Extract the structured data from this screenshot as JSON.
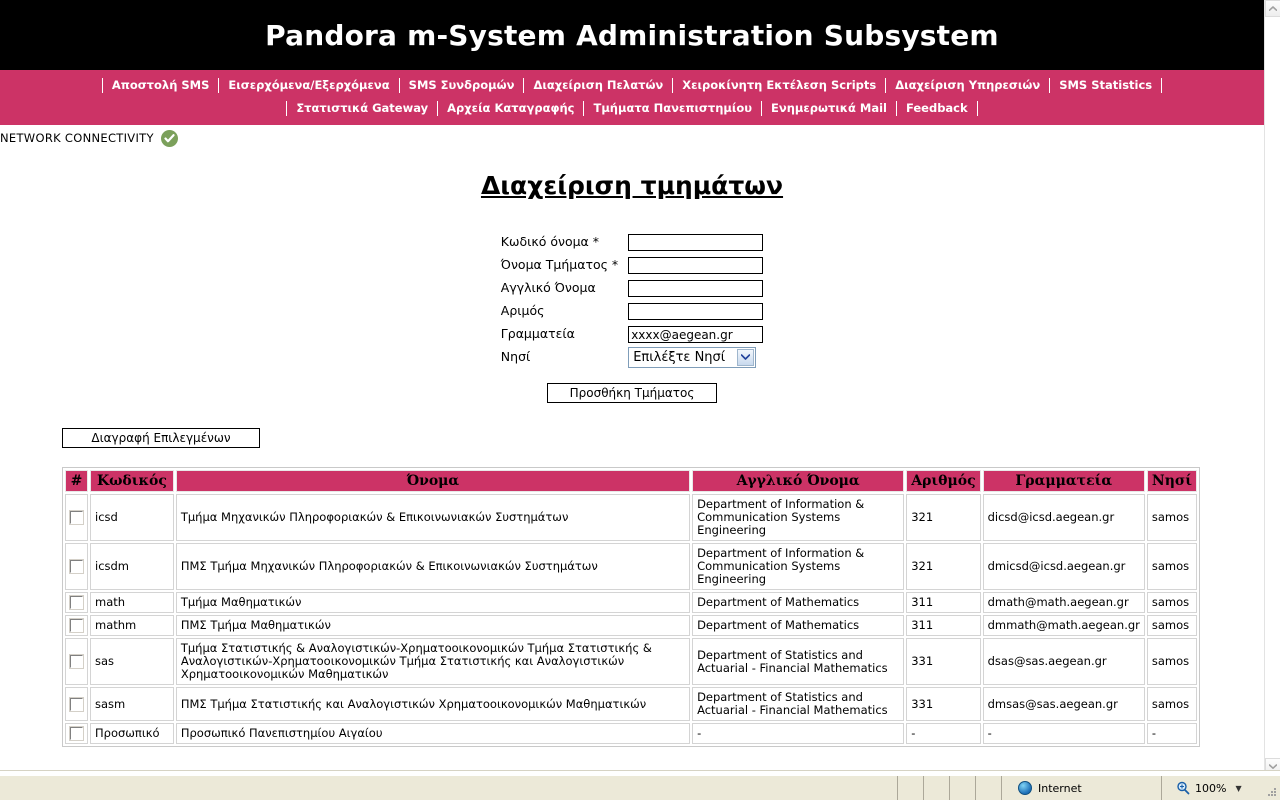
{
  "banner": {
    "title": "Pandora m-System Administration Subsystem"
  },
  "colors": {
    "banner_bg": "#000000",
    "nav_bg": "#cc3366",
    "table_header_bg": "#cc3366",
    "status_ok": "#7ba05b"
  },
  "nav": {
    "row1": [
      {
        "label": "Αποστολή SMS"
      },
      {
        "label": "Εισερχόμενα/Εξερχόμενα"
      },
      {
        "label": "SMS Συνδρομών"
      },
      {
        "label": "Διαχείριση Πελατών"
      },
      {
        "label": "Χειροκίνητη Εκτέλεση Scripts"
      },
      {
        "label": "Διαχείριση Υπηρεσιών"
      },
      {
        "label": "SMS Statistics"
      }
    ],
    "row2": [
      {
        "label": "Στατιστικά Gateway"
      },
      {
        "label": "Αρχεία Καταγραφής"
      },
      {
        "label": "Τμήματα Πανεπιστημίου"
      },
      {
        "label": "Ενημερωτικά Mail"
      },
      {
        "label": "Feedback"
      }
    ]
  },
  "connectivity": {
    "label": "NETWORK CONNECTIVITY",
    "icon": "check-circle-icon",
    "state": "ok"
  },
  "page": {
    "title": "Διαχείριση τμημάτων"
  },
  "form": {
    "fields": [
      {
        "label": "Κωδικό όνομα *",
        "value": "",
        "placeholder": ""
      },
      {
        "label": "Όνομα Τμήματος *",
        "value": "",
        "placeholder": ""
      },
      {
        "label": "Αγγλικό Όνομα",
        "value": "",
        "placeholder": ""
      },
      {
        "label": "Αριμός",
        "value": "",
        "placeholder": ""
      },
      {
        "label": "Γραμματεία",
        "value": "xxxx@aegean.gr",
        "placeholder": ""
      }
    ],
    "island": {
      "label": "Νησί",
      "selected": "Επιλέξτε Νησί",
      "options": [
        "Επιλέξτε Νησί"
      ]
    },
    "submit_label": "Προσθήκη Τμήματος"
  },
  "actions": {
    "delete_selected_label": "Διαγραφή Επιλεγμένων"
  },
  "table": {
    "headers": [
      "#",
      "Κωδικός",
      "Όνομα",
      "Αγγλικό Όνομα",
      "Αριθμός",
      "Γραμματεία",
      "Νησί"
    ],
    "rows": [
      {
        "code": "icsd",
        "name": "Τμήμα Μηχανικών Πληροφοριακών & Επικοινωνιακών Συστημάτων",
        "english": "Department of Information & Communication Systems Engineering",
        "number": "321",
        "secretariat": "dicsd@icsd.aegean.gr",
        "island": "samos",
        "checked": false
      },
      {
        "code": "icsdm",
        "name": "ΠΜΣ Τμήμα Μηχανικών Πληροφοριακών & Επικοινωνιακών Συστημάτων",
        "english": "Department of Information & Communication Systems Engineering",
        "number": "321",
        "secretariat": "dmicsd@icsd.aegean.gr",
        "island": "samos",
        "checked": false
      },
      {
        "code": "math",
        "name": "Τμήμα Μαθηματικών",
        "english": "Department of Mathematics",
        "number": "311",
        "secretariat": "dmath@math.aegean.gr",
        "island": "samos",
        "checked": false
      },
      {
        "code": "mathm",
        "name": "ΠΜΣ Τμήμα Μαθηματικών",
        "english": "Department of Mathematics",
        "number": "311",
        "secretariat": "dmmath@math.aegean.gr",
        "island": "samos",
        "checked": false
      },
      {
        "code": "sas",
        "name": "Τμήμα Στατιστικής & Αναλογιστικών-Χρηματοοικονομικών Τμήμα Στατιστικής & Αναλογιστικών-Χρηματοοικονομικών Τμήμα Στατιστικής και Αναλογιστικών Χρηματοοικονομικών Μαθηματικών",
        "english": "Department of Statistics and Actuarial - Financial Mathematics",
        "number": "331",
        "secretariat": "dsas@sas.aegean.gr",
        "island": "samos",
        "checked": false
      },
      {
        "code": "sasm",
        "name": "ΠΜΣ Τμήμα Στατιστικής και Αναλογιστικών Χρηματοοικονομικών Μαθηματικών",
        "english": "Department of Statistics and Actuarial - Financial Mathematics",
        "number": "331",
        "secretariat": "dmsas@sas.aegean.gr",
        "island": "samos",
        "checked": false
      },
      {
        "code": "Προσωπικό",
        "name": "Προσωπικό Πανεπιστημίου Αιγαίου",
        "english": "-",
        "number": "-",
        "secretariat": "-",
        "island": "-",
        "checked": false
      }
    ]
  },
  "statusbar": {
    "zone_label": "Internet",
    "zone_icon": "globe-icon",
    "zoom_label": "100%",
    "zoom_icon": "magnifier-icon"
  }
}
